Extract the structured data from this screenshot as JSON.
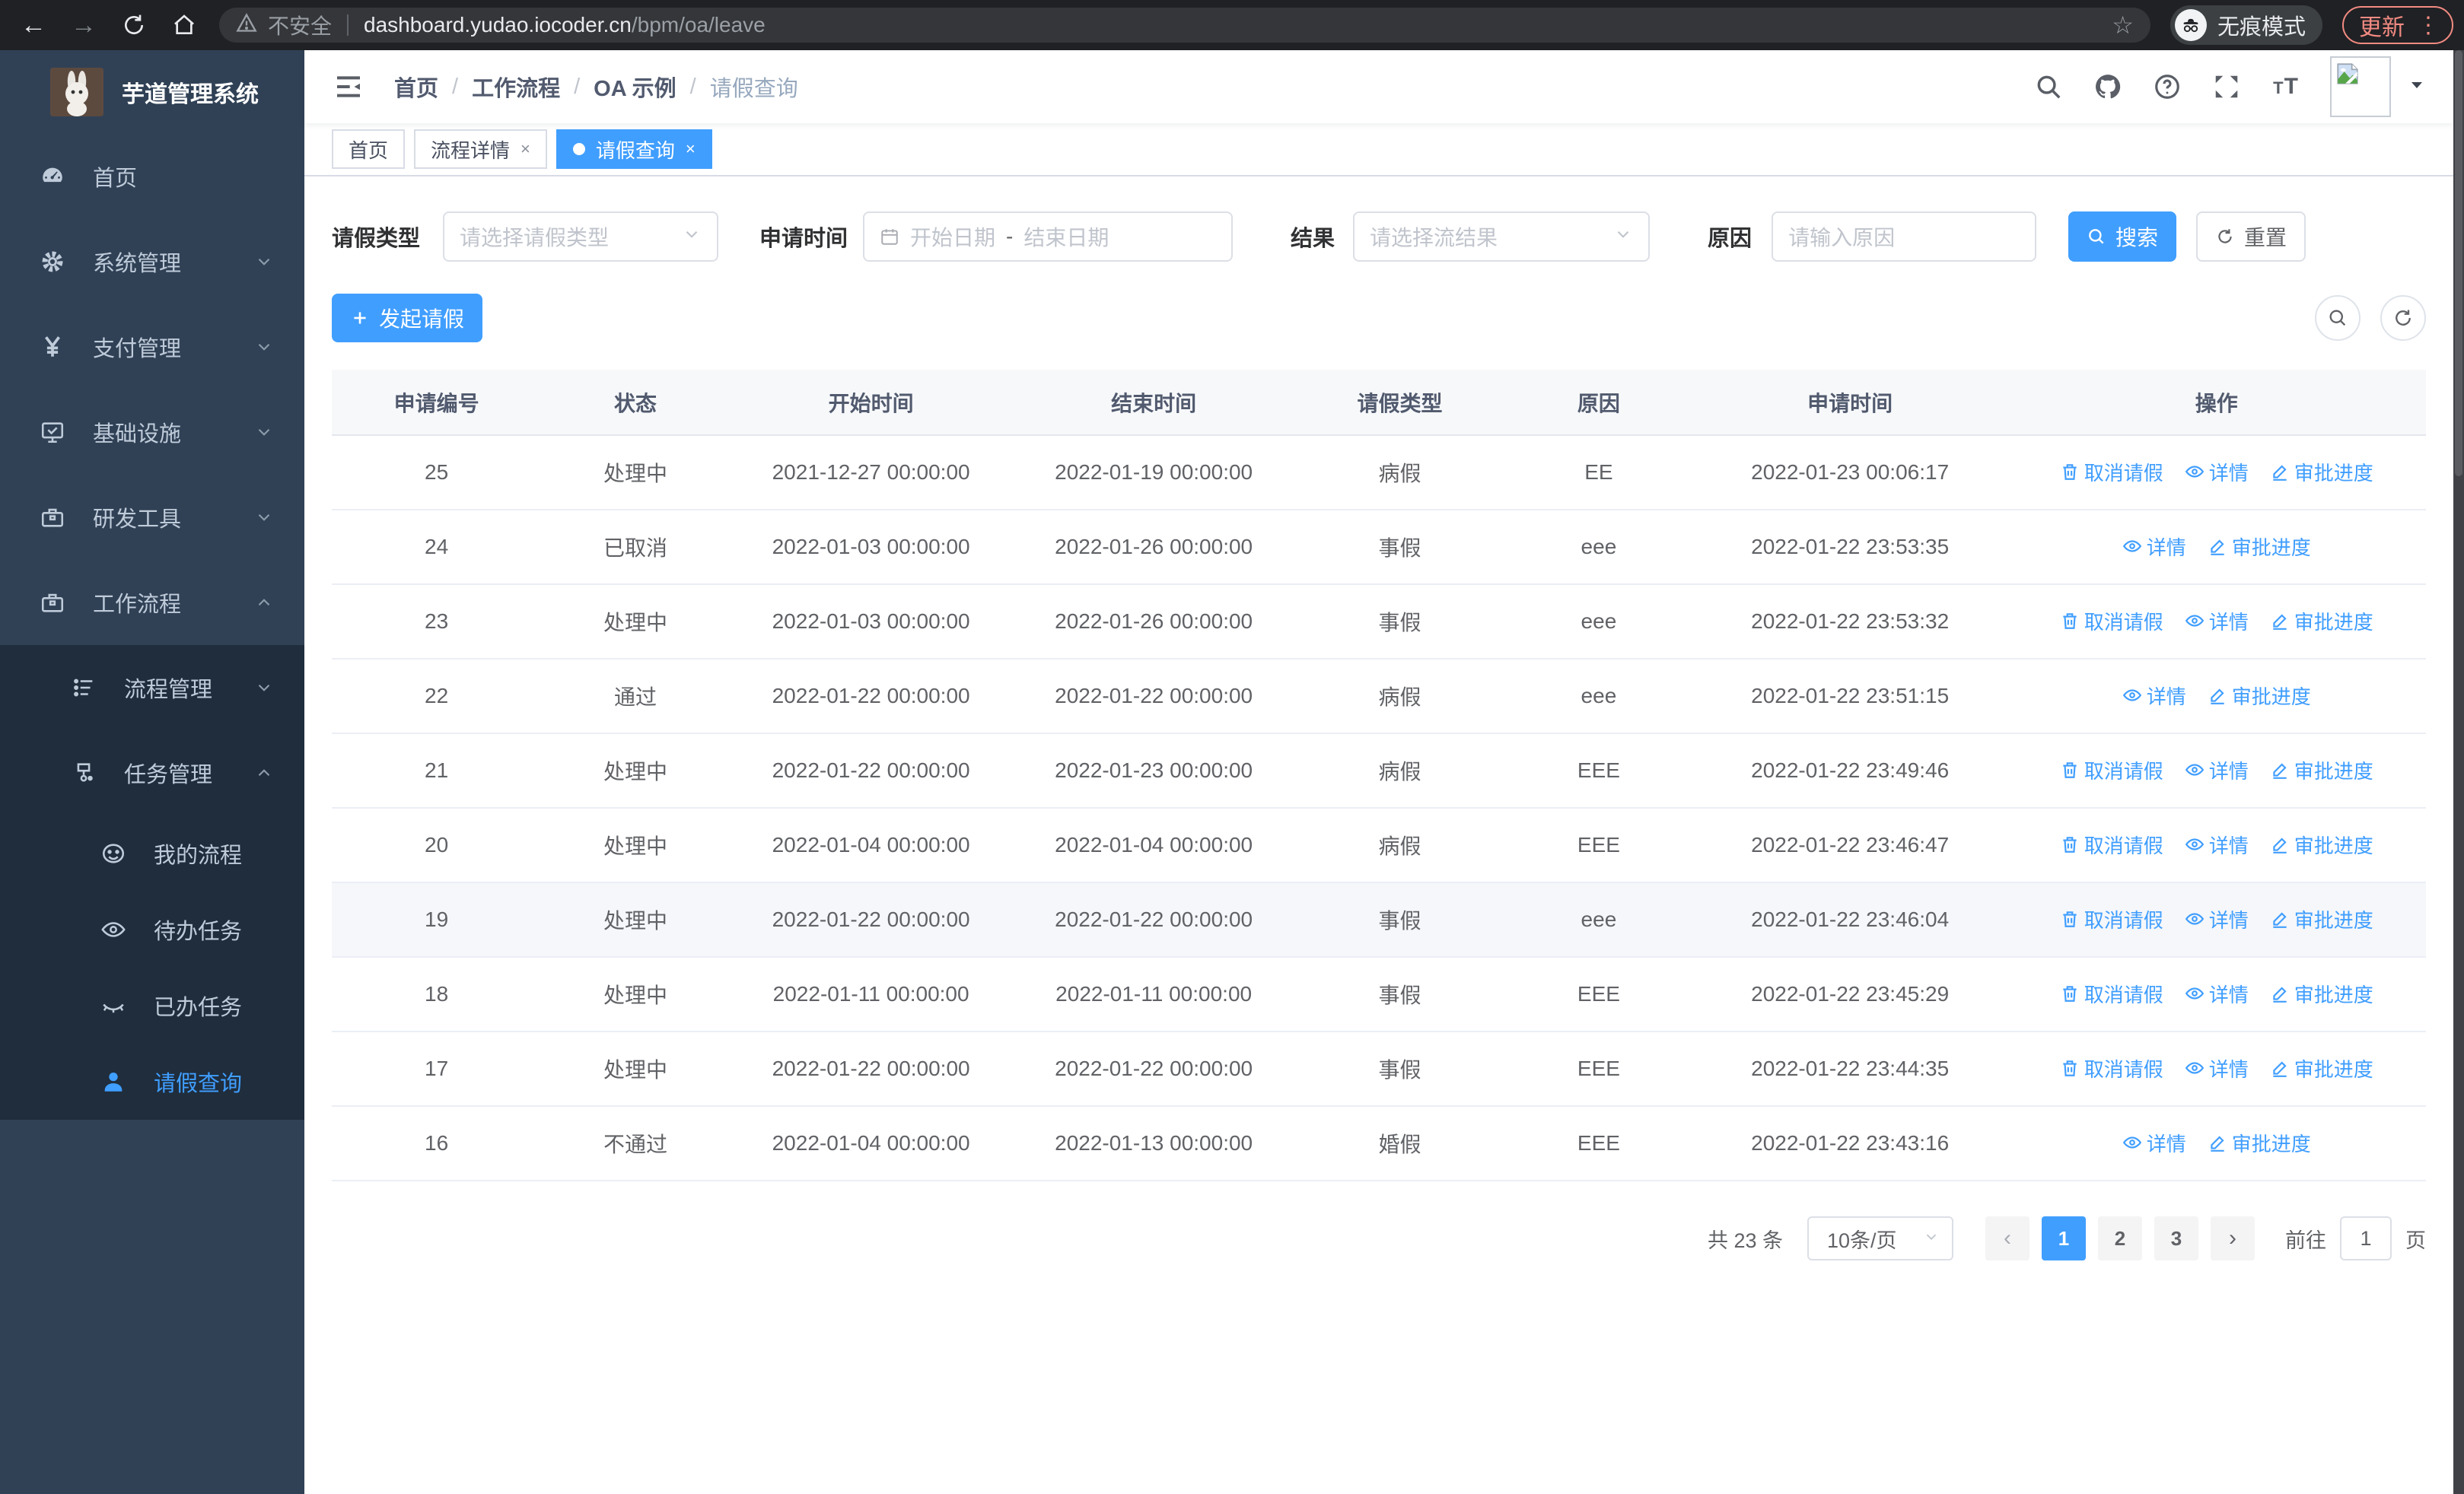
{
  "browser": {
    "security_label": "不安全",
    "url_host": "dashboard.yudao.iocoder.cn",
    "url_path": "/bpm/oa/leave",
    "incognito_label": "无痕模式",
    "update_label": "更新",
    "menu_dots": "⋮",
    "back": "←",
    "forward": "→"
  },
  "sidebar": {
    "title": "芋道管理系统",
    "items": [
      {
        "label": "首页",
        "icon": "dashboard-icon",
        "level": 1,
        "caret": null,
        "active": false,
        "dark": false
      },
      {
        "label": "系统管理",
        "icon": "gear-icon",
        "level": 1,
        "caret": "down",
        "active": false,
        "dark": false
      },
      {
        "label": "支付管理",
        "icon": "yen-icon",
        "level": 1,
        "caret": "down",
        "active": false,
        "dark": false
      },
      {
        "label": "基础设施",
        "icon": "monitor-icon",
        "level": 1,
        "caret": "down",
        "active": false,
        "dark": false
      },
      {
        "label": "研发工具",
        "icon": "toolbox-icon",
        "level": 1,
        "caret": "down",
        "active": false,
        "dark": false
      },
      {
        "label": "工作流程",
        "icon": "briefcase-icon",
        "level": 1,
        "caret": "up",
        "active": false,
        "dark": false
      },
      {
        "label": "流程管理",
        "icon": "flow-icon",
        "level": 2,
        "caret": "down",
        "active": false,
        "dark": true
      },
      {
        "label": "任务管理",
        "icon": "tasks-icon",
        "level": 2,
        "caret": "up",
        "active": false,
        "dark": true
      },
      {
        "label": "我的流程",
        "icon": "face-icon",
        "level": 3,
        "caret": null,
        "active": false,
        "dark": true
      },
      {
        "label": "待办任务",
        "icon": "eye-open-icon",
        "level": 3,
        "caret": null,
        "active": false,
        "dark": true
      },
      {
        "label": "已办任务",
        "icon": "eye-closed-icon",
        "level": 3,
        "caret": null,
        "active": false,
        "dark": true
      },
      {
        "label": "请假查询",
        "icon": "user-icon",
        "level": 3,
        "caret": null,
        "active": true,
        "dark": true
      }
    ]
  },
  "breadcrumb": [
    "首页",
    "工作流程",
    "OA 示例",
    "请假查询"
  ],
  "tabs": [
    {
      "label": "首页",
      "closable": false,
      "active": false
    },
    {
      "label": "流程详情",
      "closable": true,
      "active": false
    },
    {
      "label": "请假查询",
      "closable": true,
      "active": true
    }
  ],
  "filters": {
    "leave_type_label": "请假类型",
    "leave_type_placeholder": "请选择请假类型",
    "apply_time_label": "申请时间",
    "start_date_placeholder": "开始日期",
    "range_separator": "-",
    "end_date_placeholder": "结束日期",
    "result_label": "结果",
    "result_placeholder": "请选择流结果",
    "reason_label": "原因",
    "reason_placeholder": "请输入原因",
    "search_label": "搜索",
    "reset_label": "重置"
  },
  "toolbar": {
    "create_label": "发起请假"
  },
  "table": {
    "columns": [
      "申请编号",
      "状态",
      "开始时间",
      "结束时间",
      "请假类型",
      "原因",
      "申请时间",
      "操作"
    ],
    "col_widths": [
      "10%",
      "9%",
      "13.5%",
      "13.5%",
      "10%",
      "9%",
      "15%",
      "20%"
    ],
    "action_labels": {
      "cancel": "取消请假",
      "detail": "详情",
      "progress": "审批进度"
    },
    "rows": [
      {
        "id": "25",
        "status": "处理中",
        "start": "2021-12-27 00:00:00",
        "end": "2022-01-19 00:00:00",
        "type": "病假",
        "reason": "EE",
        "apply_time": "2022-01-23 00:06:17",
        "actions": [
          "cancel",
          "detail",
          "progress"
        ],
        "highlight": false
      },
      {
        "id": "24",
        "status": "已取消",
        "start": "2022-01-03 00:00:00",
        "end": "2022-01-26 00:00:00",
        "type": "事假",
        "reason": "eee",
        "apply_time": "2022-01-22 23:53:35",
        "actions": [
          "detail",
          "progress"
        ],
        "highlight": false
      },
      {
        "id": "23",
        "status": "处理中",
        "start": "2022-01-03 00:00:00",
        "end": "2022-01-26 00:00:00",
        "type": "事假",
        "reason": "eee",
        "apply_time": "2022-01-22 23:53:32",
        "actions": [
          "cancel",
          "detail",
          "progress"
        ],
        "highlight": false
      },
      {
        "id": "22",
        "status": "通过",
        "start": "2022-01-22 00:00:00",
        "end": "2022-01-22 00:00:00",
        "type": "病假",
        "reason": "eee",
        "apply_time": "2022-01-22 23:51:15",
        "actions": [
          "detail",
          "progress"
        ],
        "highlight": false
      },
      {
        "id": "21",
        "status": "处理中",
        "start": "2022-01-22 00:00:00",
        "end": "2022-01-23 00:00:00",
        "type": "病假",
        "reason": "EEE",
        "apply_time": "2022-01-22 23:49:46",
        "actions": [
          "cancel",
          "detail",
          "progress"
        ],
        "highlight": false
      },
      {
        "id": "20",
        "status": "处理中",
        "start": "2022-01-04 00:00:00",
        "end": "2022-01-04 00:00:00",
        "type": "病假",
        "reason": "EEE",
        "apply_time": "2022-01-22 23:46:47",
        "actions": [
          "cancel",
          "detail",
          "progress"
        ],
        "highlight": false
      },
      {
        "id": "19",
        "status": "处理中",
        "start": "2022-01-22 00:00:00",
        "end": "2022-01-22 00:00:00",
        "type": "事假",
        "reason": "eee",
        "apply_time": "2022-01-22 23:46:04",
        "actions": [
          "cancel",
          "detail",
          "progress"
        ],
        "highlight": true
      },
      {
        "id": "18",
        "status": "处理中",
        "start": "2022-01-11 00:00:00",
        "end": "2022-01-11 00:00:00",
        "type": "事假",
        "reason": "EEE",
        "apply_time": "2022-01-22 23:45:29",
        "actions": [
          "cancel",
          "detail",
          "progress"
        ],
        "highlight": false
      },
      {
        "id": "17",
        "status": "处理中",
        "start": "2022-01-22 00:00:00",
        "end": "2022-01-22 00:00:00",
        "type": "事假",
        "reason": "EEE",
        "apply_time": "2022-01-22 23:44:35",
        "actions": [
          "cancel",
          "detail",
          "progress"
        ],
        "highlight": false
      },
      {
        "id": "16",
        "status": "不通过",
        "start": "2022-01-04 00:00:00",
        "end": "2022-01-13 00:00:00",
        "type": "婚假",
        "reason": "EEE",
        "apply_time": "2022-01-22 23:43:16",
        "actions": [
          "detail",
          "progress"
        ],
        "highlight": false
      }
    ]
  },
  "pagination": {
    "total_label": "共 23 条",
    "page_size_label": "10条/页",
    "pages": [
      "1",
      "2",
      "3"
    ],
    "active_page": "1",
    "prev": "‹",
    "next": "›",
    "goto_label": "前往",
    "goto_value": "1",
    "page_unit_label": "页"
  },
  "colors": {
    "primary": "#409eff",
    "sidebar_bg": "#304156",
    "submenu_bg": "#1f2d3d",
    "sidebar_text": "#bfcbd9",
    "chrome_bg": "#202124",
    "update_accent": "#f28b82",
    "table_border": "#ebeef5",
    "header_text": "#515a6e",
    "cell_text": "#606266"
  }
}
